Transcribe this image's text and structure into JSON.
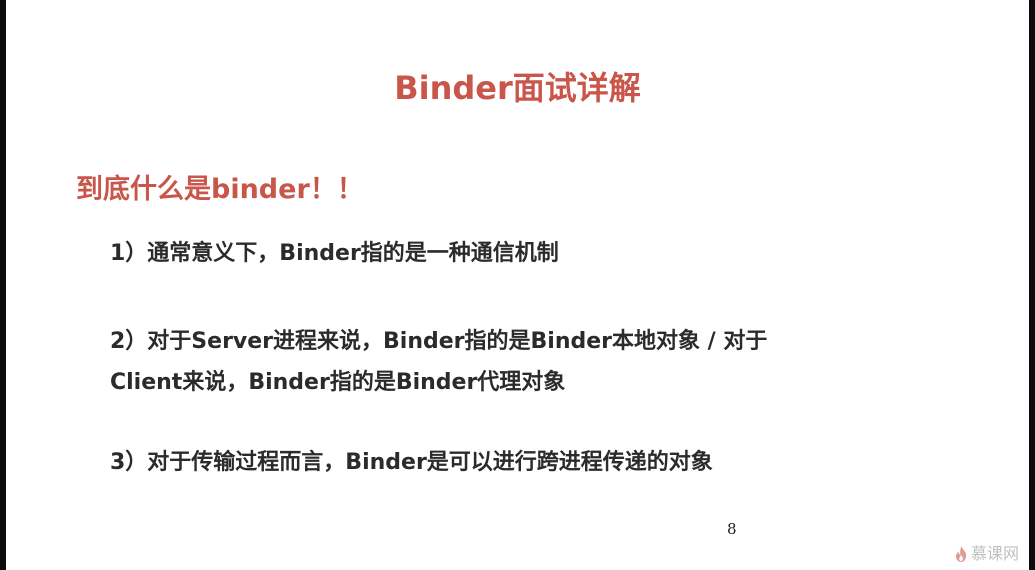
{
  "slide": {
    "title": "Binder面试详解",
    "subtitle": "到底什么是binder！！",
    "points": [
      {
        "lines": [
          "1）通常意义下，Binder指的是一种通信机制"
        ]
      },
      {
        "lines": [
          "2）对于Server进程来说，Binder指的是Binder本地对象 / 对于",
          "Client来说，Binder指的是Binder代理对象"
        ]
      },
      {
        "lines": [
          "3）对于传输过程而言，Binder是可以进行跨进程传递的对象"
        ]
      }
    ],
    "page_number": "8"
  },
  "watermark": {
    "icon": "flame-logo-icon",
    "text": "慕课网"
  },
  "colors": {
    "accent": "#c8564a",
    "body_text": "#2b2b2b",
    "background": "#ffffff",
    "frame": "#0b0b0b"
  }
}
